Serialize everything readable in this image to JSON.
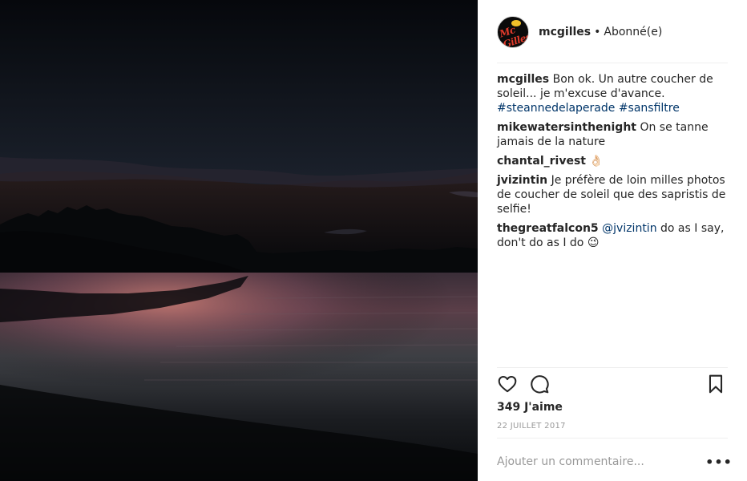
{
  "post": {
    "author": "mcgilles",
    "separator": "•",
    "follow_state": "Abonné(e)",
    "avatar_text": "Mc Gilles"
  },
  "caption": {
    "author": "mcgilles",
    "text": "Bon ok. Un autre coucher de soleil... je m'excuse d'avance.",
    "hashtags": "#steannedelaperade #sansfiltre"
  },
  "comments": [
    {
      "author": "mikewatersinthenight",
      "text": "On se tanne jamais de la nature"
    },
    {
      "author": "chantal_rivest",
      "text": "👌🏻"
    },
    {
      "author": "jvizintin",
      "text": "Je préfère de loin milles photos de coucher de soleil que des sapristis de selfie!"
    },
    {
      "author": "thegreatfalcon5",
      "mention": "@jvizintin",
      "text": "do as I say, don't do as I do 😉"
    }
  ],
  "stats": {
    "likes": "349 J'aime",
    "date": "22 JUILLET 2017"
  },
  "comment_box": {
    "placeholder": "Ajouter un commentaire...",
    "more": "•••"
  },
  "icons": {
    "like": "heart-icon",
    "comment": "speech-bubble-icon",
    "save": "bookmark-icon"
  },
  "colors": {
    "link": "#003569",
    "muted": "#999999",
    "sky_glow": "#f08a5c",
    "sky_pink": "#e07a8a"
  }
}
